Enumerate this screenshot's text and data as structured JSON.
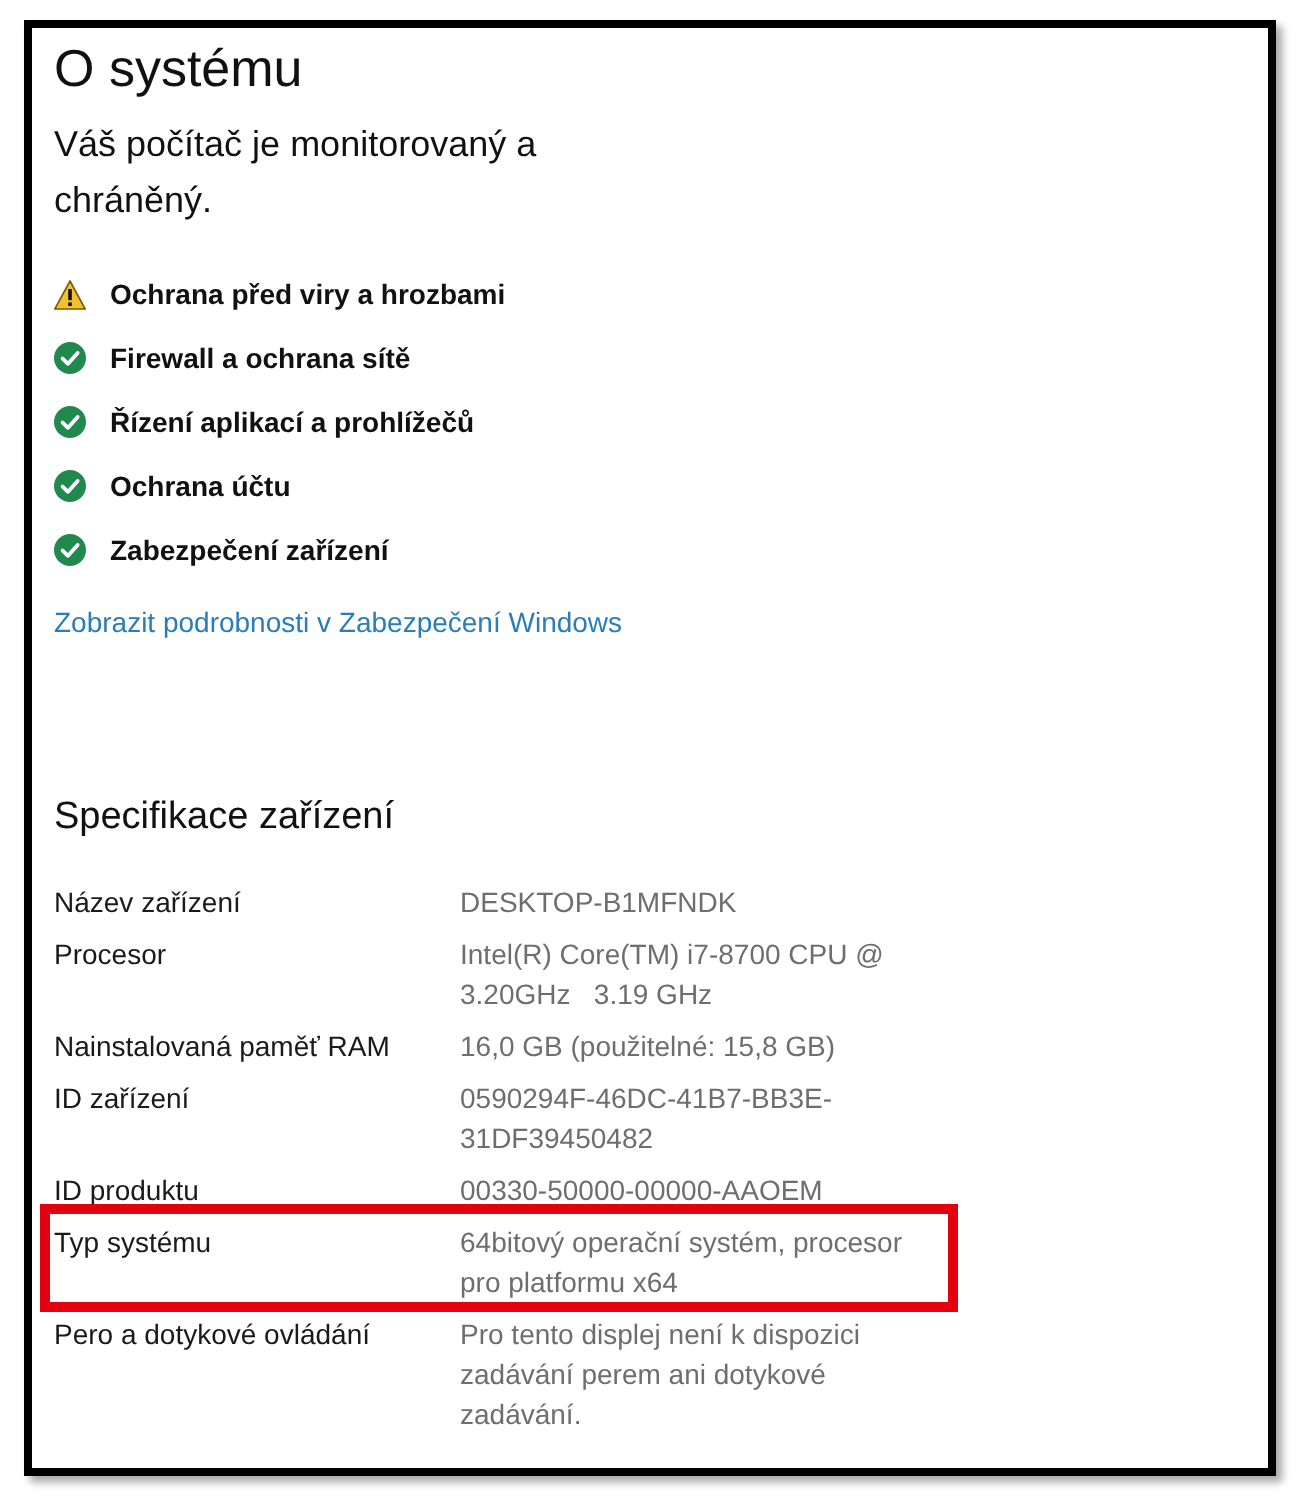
{
  "page": {
    "title": "O systému",
    "status_summary": "Váš počítač je monitorovaný a chráněný."
  },
  "protection_items": [
    {
      "label": "Ochrana před viry a hrozbami",
      "kind": "warning"
    },
    {
      "label": "Firewall a ochrana sítě",
      "kind": "ok"
    },
    {
      "label": "Řízení aplikací a prohlížečů",
      "kind": "ok"
    },
    {
      "label": "Ochrana účtu",
      "kind": "ok"
    },
    {
      "label": "Zabezpečení zařízení",
      "kind": "ok"
    }
  ],
  "details_link": "Zobrazit podrobnosti v Zabezpečení Windows",
  "device_specs": {
    "title": "Specifikace zařízení",
    "rows": [
      {
        "label": "Název zařízení",
        "value": "DESKTOP-B1MFNDK",
        "highlighted": false
      },
      {
        "label": "Procesor",
        "value": "Intel(R) Core(TM) i7-8700 CPU @ 3.20GHz   3.19 GHz",
        "highlighted": false
      },
      {
        "label": "Nainstalovaná paměť RAM",
        "value": "16,0 GB (použitelné: 15,8 GB)",
        "highlighted": false
      },
      {
        "label": "ID zařízení",
        "value": "0590294F-46DC-41B7-BB3E-31DF39450482",
        "highlighted": false
      },
      {
        "label": "ID produktu",
        "value": "00330-50000-00000-AAOEM",
        "highlighted": false
      },
      {
        "label": "Typ systému",
        "value": "64bitový operační systém, procesor pro platformu x64",
        "highlighted": true
      },
      {
        "label": "Pero a dotykové ovládání",
        "value": "Pro tento displej není k dispozici zadávání perem ani dotykové zadávání.",
        "highlighted": false
      }
    ]
  }
}
